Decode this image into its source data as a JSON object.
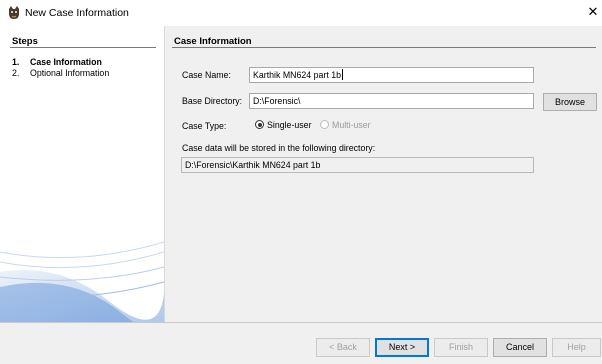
{
  "window": {
    "title": "New Case Information",
    "close_glyph": "✕"
  },
  "steps": {
    "title": "Steps",
    "items": [
      {
        "num": "1.",
        "label": "Case Information"
      },
      {
        "num": "2.",
        "label": "Optional Information"
      }
    ]
  },
  "content": {
    "title": "Case Information",
    "case_name_label": "Case Name:",
    "case_name_value": "Karthik MN624 part 1b",
    "base_dir_label": "Base Directory:",
    "base_dir_value": "D:\\Forensic\\",
    "browse_label": "Browse",
    "case_type_label": "Case Type:",
    "case_type_options": [
      "Single-user",
      "Multi-user"
    ],
    "case_type_selected": "Single-user",
    "stored_label": "Case data will be stored in the following directory:",
    "stored_value": "D:\\Forensic\\Karthik MN624 part 1b"
  },
  "footer": {
    "back_label": "< Back",
    "next_label": "Next >",
    "finish_label": "Finish",
    "cancel_label": "Cancel",
    "help_label": "Help"
  },
  "colors": {
    "accent": "#0078d7",
    "panel_art": "#5b8fd6"
  }
}
